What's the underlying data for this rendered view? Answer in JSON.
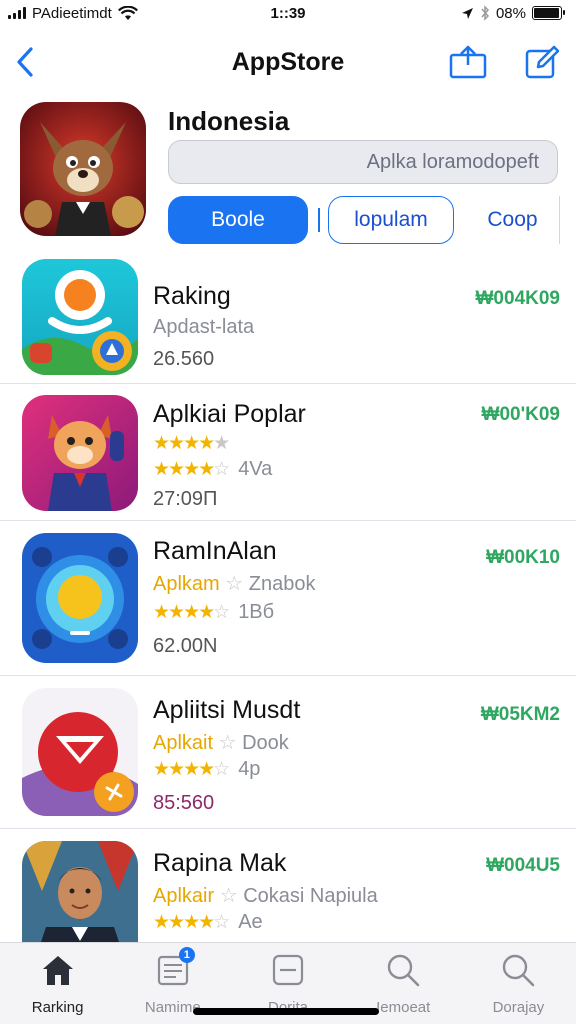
{
  "status_bar": {
    "carrier": "PAdieetimdt",
    "time": "1::39",
    "battery": "08%"
  },
  "nav": {
    "title": "AppStore",
    "icons": [
      "back-chevron-icon",
      "share-icon",
      "compose-icon"
    ]
  },
  "header": {
    "region": "Indonesia",
    "search_value": "Aplka loramodopeft",
    "segments": [
      "Boole",
      "lopulam",
      "Coop"
    ]
  },
  "apps": [
    {
      "title": "Raking",
      "subtitle": "Apdast-lata",
      "category": "",
      "rating_label": "",
      "count": "26.560",
      "price": "₩004K09"
    },
    {
      "title": "Aplkiai Poplar",
      "subtitle": "",
      "category": "",
      "rating_label": "4Va",
      "count": "27:09Π",
      "price": "₩00'K09"
    },
    {
      "title": "RamInAlan",
      "subtitle": "Znabok",
      "category": "Aplkam",
      "rating_label": "1Bб",
      "count": "62.00N",
      "price": "₩00K10"
    },
    {
      "title": "Apliitsi Musdt",
      "subtitle": "Dook",
      "category": "Aplkait",
      "rating_label": "4p",
      "count": "85:560",
      "price": "₩05KM2"
    },
    {
      "title": "Rapina Mak",
      "subtitle": "Cokasi Napiula",
      "category": "Aplkair",
      "rating_label": "Ae",
      "count": "",
      "price": "₩004U5"
    }
  ],
  "tabs": [
    {
      "label": "Rarking",
      "icon": "home-icon",
      "active": true
    },
    {
      "label": "Namime",
      "icon": "news-icon",
      "badge": "1",
      "active": false
    },
    {
      "label": "Dorita",
      "icon": "list-icon",
      "active": false
    },
    {
      "label": "Iemoeat",
      "icon": "search-icon",
      "active": false
    },
    {
      "label": "Dorajay",
      "icon": "search-icon",
      "active": false
    }
  ],
  "colors": {
    "accent": "#1a73f0",
    "price": "#2fa761",
    "star": "#f2b400"
  }
}
